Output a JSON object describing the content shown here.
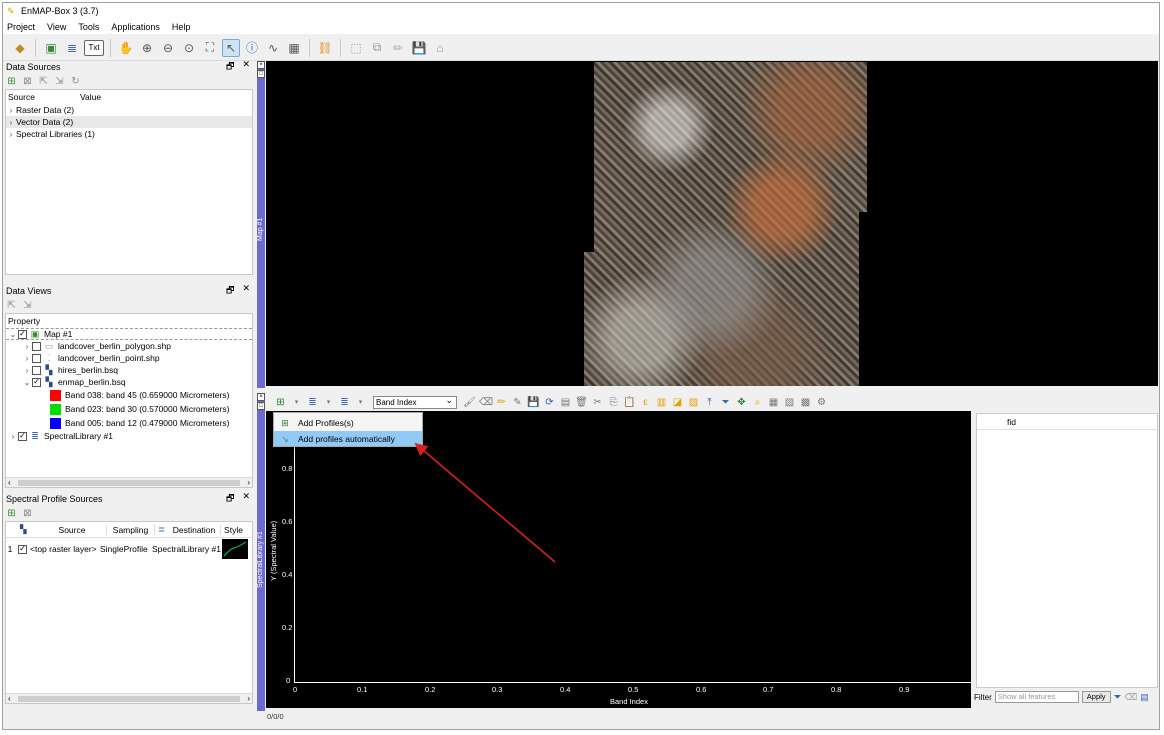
{
  "window": {
    "title": "EnMAP-Box 3 (3.7)"
  },
  "menubar": [
    "Project",
    "View",
    "Tools",
    "Applications",
    "Help"
  ],
  "toolbar": {
    "txt_label": "Txt"
  },
  "data_sources": {
    "title": "Data Sources",
    "col_source": "Source",
    "col_value": "Value",
    "items": [
      "Raster Data (2)",
      "Vector Data (2)",
      "Spectral Libraries (1)"
    ]
  },
  "data_views": {
    "title": "Data Views",
    "col_property": "Property",
    "map": "Map #1",
    "layers": [
      "landcover_berlin_polygon.shp",
      "landcover_berlin_point.shp",
      "hires_berlin.bsq",
      "enmap_berlin.bsq"
    ],
    "bands": [
      {
        "label": "Band 038: band 45 (0.659000 Micrometers)",
        "color": "#ff0000"
      },
      {
        "label": "Band 023: band 30 (0.570000 Micrometers)",
        "color": "#00dd00"
      },
      {
        "label": "Band 005: band 12 (0.479000 Micrometers)",
        "color": "#0000ff"
      }
    ],
    "speclib": "SpectralLibrary #1"
  },
  "profile_sources": {
    "title": "Spectral Profile Sources",
    "headers": [
      "Source",
      "Sampling",
      "Destination",
      "Style"
    ],
    "row": {
      "index": "1",
      "source": "<top raster layer>",
      "sampling": "SingleProfile",
      "destination": "SpectralLibrary #1"
    }
  },
  "map_panel": {
    "label": "Map #1"
  },
  "speclib_panel": {
    "side_label": "SpectralLibrary #1",
    "band_select": "Band Index",
    "menu": [
      "Add Profiles(s)",
      "Add profiles automatically"
    ],
    "y_label": "Y (Spectral Value)",
    "x_label": "Band Index",
    "y_ticks": [
      "1",
      "0.8",
      "0.6",
      "0.4",
      "0.2",
      "0"
    ],
    "x_ticks": [
      "0",
      "0.1",
      "0.2",
      "0.3",
      "0.4",
      "0.5",
      "0.6",
      "0.7",
      "0.8",
      "0.9"
    ],
    "status": "0/0/0"
  },
  "attribute_table": {
    "column": "fid",
    "filter_label": "Filter",
    "filter_placeholder": "Show all features",
    "apply": "Apply"
  },
  "colors": {
    "view_bar": "#6a6ad0",
    "menu_highlight": "#91c9f7",
    "arrow": "#d62020"
  }
}
